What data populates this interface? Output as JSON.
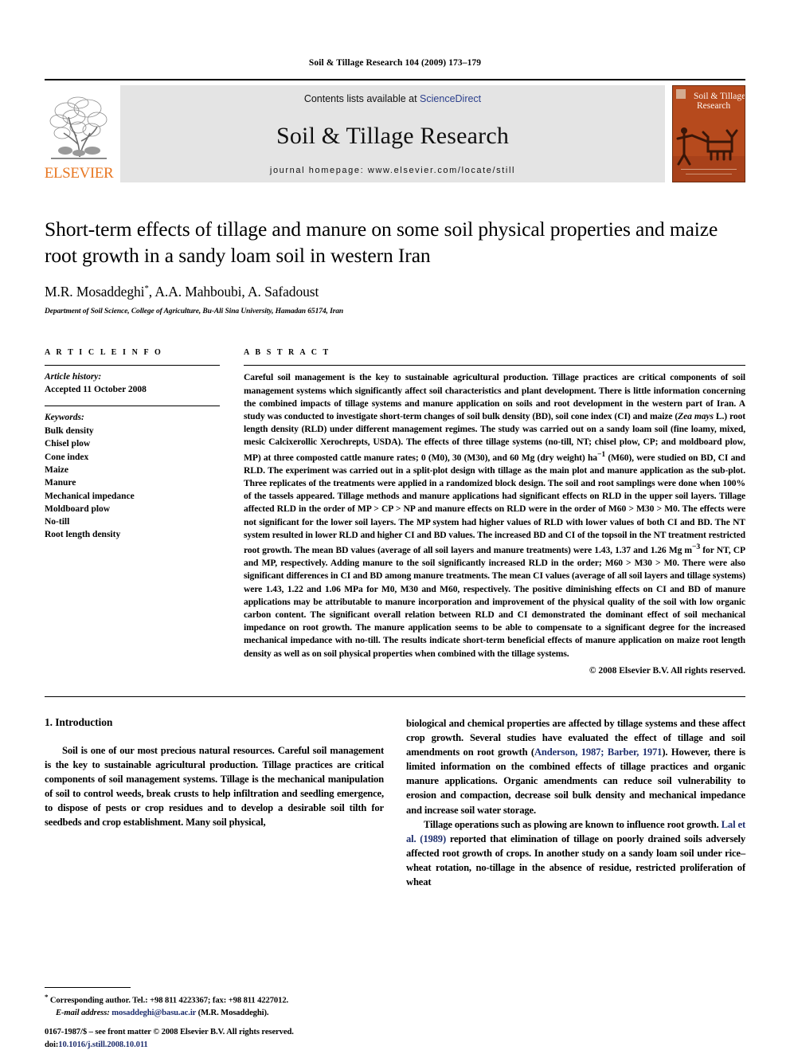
{
  "running_head": "Soil & Tillage Research 104 (2009) 173–179",
  "masthead": {
    "publisher_name": "ELSEVIER",
    "contents_text": "Contents lists available at ",
    "sciencedirect": "ScienceDirect",
    "journal_title": "Soil & Tillage Research",
    "homepage": "journal homepage: www.elsevier.com/locate/still",
    "cover_title_line1": "Soil & Tillage",
    "cover_title_line2": "Research",
    "cover_color": "#b64a1d",
    "sciencedirect_color": "#2b3f8c",
    "elsevier_orange": "#E87722",
    "banner_background": "#e4e4e4"
  },
  "article": {
    "title": "Short-term effects of tillage and manure on some soil physical properties and maize root growth in a sandy loam soil in western Iran",
    "authors": "M.R. Mosaddeghi",
    "authors_rest": ", A.A. Mahboubi, A. Safadoust",
    "corresponding_marker": "*",
    "affiliation": "Department of Soil Science, College of Agriculture, Bu-Ali Sina University, Hamadan 65174, Iran"
  },
  "article_info": {
    "heading": "A R T I C L E  I N F O",
    "history_label": "Article history:",
    "history_value": "Accepted 11 October 2008",
    "keywords_label": "Keywords:",
    "keywords": [
      "Bulk density",
      "Chisel plow",
      "Cone index",
      "Maize",
      "Manure",
      "Mechanical impedance",
      "Moldboard plow",
      "No-till",
      "Root length density"
    ]
  },
  "abstract": {
    "heading": "A B S T R A C T",
    "part1": "Careful soil management is the key to sustainable agricultural production. Tillage practices are critical components of soil management systems which significantly affect soil characteristics and plant development. There is little information concerning the combined impacts of tillage systems and manure application on soils and root development in the western part of Iran. A study was conducted to investigate short-term changes of soil bulk density (BD), soil cone index (CI) and maize (",
    "italic1": "Zea mays",
    "part2": " L.) root length density (RLD) under different management regimes. The study was carried out on a sandy loam soil (fine loamy, mixed, mesic Calcixerollic Xerochrepts, USDA). The effects of three tillage systems (no-till, NT; chisel plow, CP; and moldboard plow, MP) at three composted cattle manure rates; 0 (M0), 30 (M30), and 60 Mg (dry weight) ha",
    "sup1": "−1",
    "part3": " (M60), were studied on BD, CI and RLD. The experiment was carried out in a split-plot design with tillage as the main plot and manure application as the sub-plot. Three replicates of the treatments were applied in a randomized block design. The soil and root samplings were done when 100% of the tassels appeared. Tillage methods and manure applications had significant effects on RLD in the upper soil layers. Tillage affected RLD in the order of MP > CP > NP and manure effects on RLD were in the order of M60 > M30 > M0. The effects were not significant for the lower soil layers. The MP system had higher values of RLD with lower values of both CI and BD. The NT system resulted in lower RLD and higher CI and BD values. The increased BD and CI of the topsoil in the NT treatment restricted root growth. The mean BD values (average of all soil layers and manure treatments) were 1.43, 1.37 and 1.26 Mg m",
    "sup2": "−3",
    "part4": " for NT, CP and MP, respectively. Adding manure to the soil significantly increased RLD in the order; M60 > M30 > M0. There were also significant differences in CI and BD among manure treatments. The mean CI values (average of all soil layers and tillage systems) were 1.43, 1.22 and 1.06 MPa for M0, M30 and M60, respectively. The positive diminishing effects on CI and BD of manure applications may be attributable to manure incorporation and improvement of the physical quality of the soil with low organic carbon content. The significant overall relation between RLD and CI demonstrated the dominant effect of soil mechanical impedance on root growth. The manure application seems to be able to compensate to a significant degree for the increased mechanical impedance with no-till. The results indicate short-term beneficial effects of manure application on maize root length density as well as on soil physical properties when combined with the tillage systems.",
    "copyright": "© 2008 Elsevier B.V. All rights reserved."
  },
  "introduction": {
    "section_title": "1. Introduction",
    "left_p1": "Soil is one of our most precious natural resources. Careful soil management is the key to sustainable agricultural production. Tillage practices are critical components of soil management systems. Tillage is the mechanical manipulation of soil to control weeds, break crusts to help infiltration and seedling emergence, to dispose of pests or crop residues and to develop a desirable soil tilth for seedbeds and crop establishment. Many soil physical,",
    "right_p1_a": "biological and chemical properties are affected by tillage systems and these affect crop growth. Several studies have evaluated the effect of tillage and soil amendments on root growth (",
    "right_p1_ref": "Anderson, 1987; Barber, 1971",
    "right_p1_b": "). However, there is limited information on the combined effects of tillage practices and organic manure applications. Organic amendments can reduce soil vulnerability to erosion and compaction, decrease soil bulk density and mechanical impedance and increase soil water storage.",
    "right_p2_a": "Tillage operations such as plowing are known to influence root growth. ",
    "right_p2_ref": "Lal et al. (1989)",
    "right_p2_b": " reported that elimination of tillage on poorly drained soils adversely affected root growth of crops. In another study on a sandy loam soil under rice–wheat rotation, no-tillage in the absence of residue, restricted proliferation of wheat"
  },
  "footnotes": {
    "corresponding_marker": "*",
    "corresponding": " Corresponding author. Tel.: +98 811 4223367; fax: +98 811 4227012.",
    "email_label": "E-mail address:",
    "email": "mosaddeghi@basu.ac.ir",
    "email_owner": " (M.R. Mosaddeghi).",
    "issn_line": "0167-1987/$ – see front matter © 2008 Elsevier B.V. All rights reserved.",
    "doi_label": "doi:",
    "doi": "10.1016/j.still.2008.10.011"
  }
}
